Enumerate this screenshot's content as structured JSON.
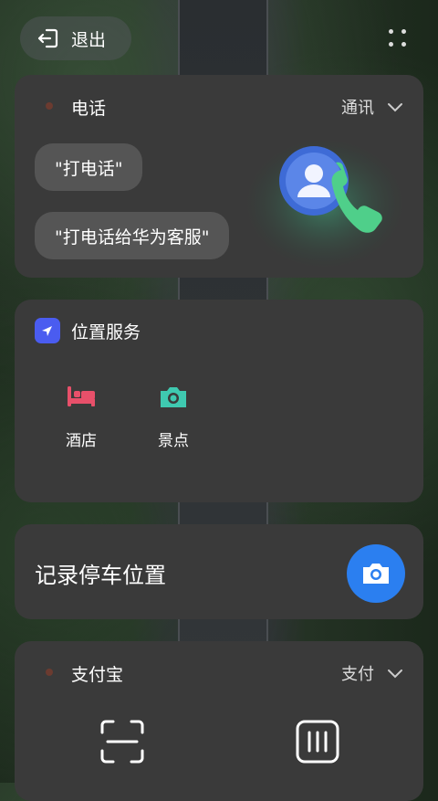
{
  "topbar": {
    "exit_label": "退出"
  },
  "phone_card": {
    "title": "电话",
    "category": "通讯",
    "suggestions": [
      "\"打电话\"",
      "\"打电话给华为客服\""
    ]
  },
  "location_card": {
    "title": "位置服务",
    "shortcuts": [
      {
        "label": "酒店",
        "icon": "hotel-bed-icon"
      },
      {
        "label": "景点",
        "icon": "camera-icon"
      }
    ]
  },
  "parking_card": {
    "title": "记录停车位置"
  },
  "alipay_card": {
    "title": "支付宝",
    "category": "支付"
  },
  "colors": {
    "card_bg": "#3a3a3a",
    "pill_bg": "#555555",
    "accent_blue": "#2b7ff0",
    "hotel_pink": "#e8506a",
    "scenic_teal": "#3fc9b0"
  }
}
